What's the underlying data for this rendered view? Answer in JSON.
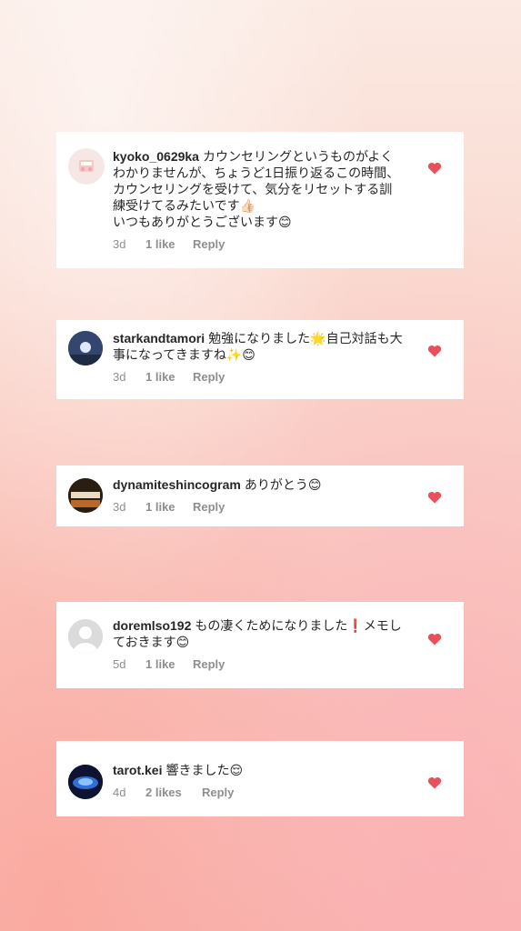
{
  "comments": [
    {
      "username": "kyoko_0629ka",
      "text": "カウンセリングというものがよくわかりませんが、ちょうど1日振り返るこの時間、カウンセリングを受けて、気分をリセットする訓練受けてるみたいです👍🏻",
      "text2": "いつもありがとうございます😊",
      "time": "3d",
      "likes": "1 like",
      "reply": "Reply",
      "liked": true
    },
    {
      "username": "starkandtamori",
      "text": "勉強になりました🌟自己対話も大事になってきますね✨😊",
      "time": "3d",
      "likes": "1 like",
      "reply": "Reply",
      "liked": true
    },
    {
      "username": "dynamiteshincogram",
      "text": "ありがとう😊",
      "time": "3d",
      "likes": "1 like",
      "reply": "Reply",
      "liked": true
    },
    {
      "username": "doremlso192",
      "text": "もの凄くためになりました❗メモしておきます😊",
      "time": "5d",
      "likes": "1 like",
      "reply": "Reply",
      "liked": true
    },
    {
      "username": "tarot.kei",
      "text": "響きました😌",
      "time": "4d",
      "likes": "2 likes",
      "reply": "Reply",
      "liked": true
    }
  ],
  "colors": {
    "heart": "#e8505b",
    "username": "#262626",
    "meta": "#8e8e8e"
  },
  "icons": {
    "like": "heart-icon",
    "default_avatar": "person-silhouette-icon"
  }
}
